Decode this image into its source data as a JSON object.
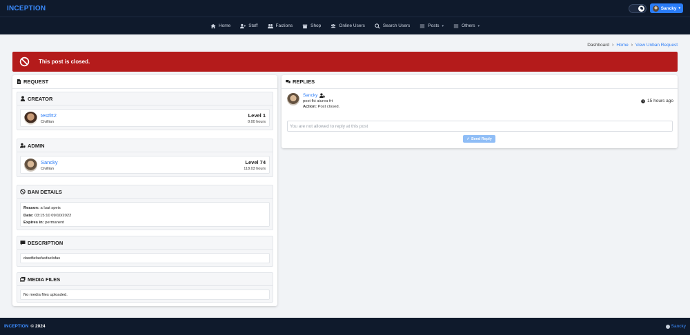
{
  "app": {
    "brand": "INCEPTION",
    "user": "Sancky"
  },
  "nav": [
    {
      "label": "Home",
      "icon": "home-icon",
      "dropdown": false
    },
    {
      "label": "Staff",
      "icon": "staff-icon",
      "dropdown": false
    },
    {
      "label": "Factions",
      "icon": "factions-icon",
      "dropdown": false
    },
    {
      "label": "Shop",
      "icon": "shop-icon",
      "dropdown": false
    },
    {
      "label": "Online Users",
      "icon": "online-users-icon",
      "dropdown": false
    },
    {
      "label": "Search Users",
      "icon": "search-icon",
      "dropdown": false
    },
    {
      "label": "Posts",
      "icon": "posts-icon",
      "dropdown": true
    },
    {
      "label": "Others",
      "icon": "others-icon",
      "dropdown": true
    }
  ],
  "breadcrumb": {
    "dashboard": "Dashboard",
    "home": "Home",
    "current": "View Unban Request"
  },
  "alert": {
    "text": "This post is closed.",
    "color": "#b41b1b"
  },
  "request": {
    "title": "REQUEST",
    "creator": {
      "title": "CREATOR",
      "name": "testfrt2",
      "role": "Civillian",
      "level": "Level 1",
      "hours": "0.00 hours"
    },
    "admin": {
      "title": "ADMIN",
      "name": "Sancky",
      "role": "Civillian",
      "level": "Level 74",
      "hours": "118.03 hours"
    },
    "ban": {
      "title": "BAN DETAILS",
      "reason_label": "Reason:",
      "reason": "a luat speis",
      "date_label": "Date:",
      "date": "03:15:10 09/10/2022",
      "expires_label": "Expires in:",
      "expires": "permanent"
    },
    "description": {
      "title": "DESCRIPTION",
      "text": "dasdfafasfasfasfafas"
    },
    "media": {
      "title": "MEDIA FILES",
      "text": "No media files uploaded."
    }
  },
  "replies": {
    "title": "REPLIES",
    "items": [
      {
        "name": "Sancky",
        "text": "post fkt aiurea frt",
        "action_label": "Action:",
        "action": "Post closed.",
        "time": "15 hours ago"
      }
    ],
    "placeholder": "You are not allowed to reply at this post",
    "send_label": "Send Reply"
  },
  "footer": {
    "brand": "INCEPTION",
    "year": "© 2024",
    "user": "Sancky"
  },
  "colors": {
    "accent": "#2a7cf7",
    "navbar": "#0f1a2c",
    "danger": "#b41b1b"
  }
}
